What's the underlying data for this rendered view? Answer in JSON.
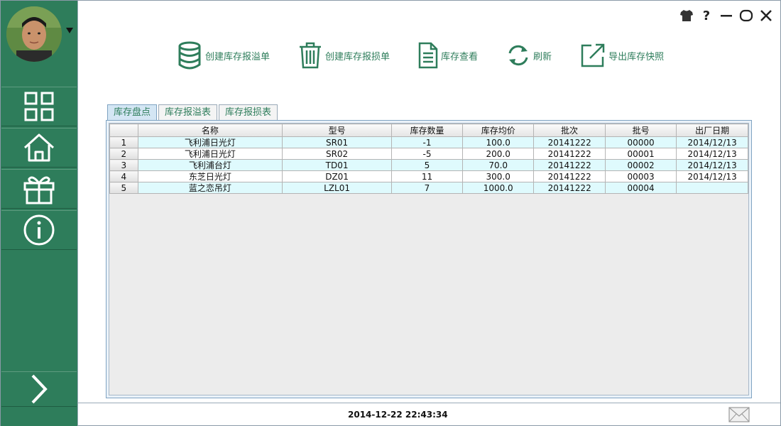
{
  "toolbar": {
    "items": [
      {
        "label": "创建库存报溢单",
        "icon": "database-icon"
      },
      {
        "label": "创建库存报损单",
        "icon": "trash-icon"
      },
      {
        "label": "库存查看",
        "icon": "document-icon"
      },
      {
        "label": "刷新",
        "icon": "refresh-icon"
      },
      {
        "label": "导出库存快照",
        "icon": "export-icon"
      }
    ]
  },
  "window_controls": {
    "skin_icon": "shirt-icon",
    "help": "?",
    "minimize": "—",
    "maximize": "○",
    "close": "✕"
  },
  "sidebar": {
    "items": [
      {
        "icon": "grid-icon"
      },
      {
        "icon": "home-icon"
      },
      {
        "icon": "gift-icon"
      },
      {
        "icon": "info-icon"
      }
    ],
    "expand_icon": "chevron-right-icon"
  },
  "tabs": [
    {
      "label": "库存盘点",
      "active": true
    },
    {
      "label": "库存报溢表",
      "active": false
    },
    {
      "label": "库存报损表",
      "active": false
    }
  ],
  "table": {
    "columns": [
      "名称",
      "型号",
      "库存数量",
      "库存均价",
      "批次",
      "批号",
      "出厂日期"
    ],
    "rows": [
      {
        "num": "1",
        "cells": [
          "飞利浦日光灯",
          "SR01",
          "-1",
          "100.0",
          "20141222",
          "00000",
          "2014/12/13"
        ]
      },
      {
        "num": "2",
        "cells": [
          "飞利浦日光灯",
          "SR02",
          "-5",
          "200.0",
          "20141222",
          "00001",
          "2014/12/13"
        ]
      },
      {
        "num": "3",
        "cells": [
          "飞利浦台灯",
          "TD01",
          "5",
          "70.0",
          "20141222",
          "00002",
          "2014/12/13"
        ]
      },
      {
        "num": "4",
        "cells": [
          "东芝日光灯",
          "DZ01",
          "11",
          "300.0",
          "20141222",
          "00003",
          "2014/12/13"
        ]
      },
      {
        "num": "5",
        "cells": [
          "蓝之恋吊灯",
          "LZL01",
          "7",
          "1000.0",
          "20141222",
          "00004",
          ""
        ]
      }
    ]
  },
  "status": {
    "datetime": "2014-12-22 22:43:34",
    "mail_icon": "mail-icon"
  },
  "colors": {
    "sidebar": "#2e7d5b",
    "accent": "#2e7d5b",
    "row_highlight": "#dffafd"
  }
}
